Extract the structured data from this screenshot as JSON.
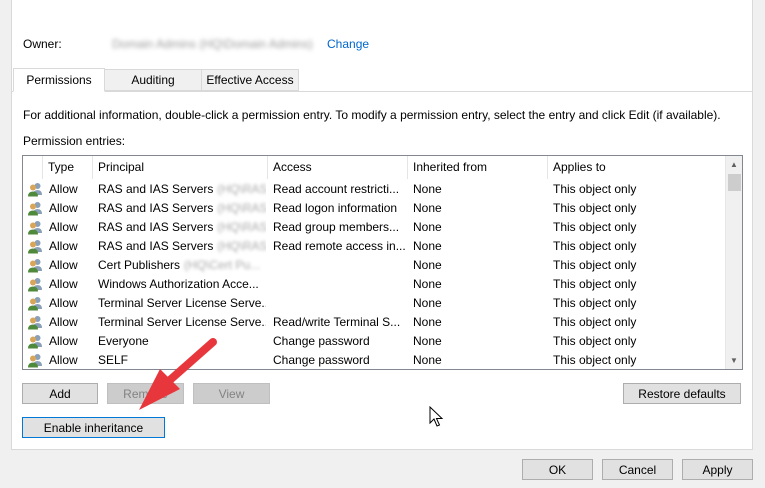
{
  "owner": {
    "label": "Owner:",
    "value": "Domain Admins (HQ\\Domain Admins)",
    "change_label": "Change"
  },
  "tabs": [
    {
      "label": "Permissions",
      "active": true
    },
    {
      "label": "Auditing",
      "active": false
    },
    {
      "label": "Effective Access",
      "active": false
    }
  ],
  "info_text": "For additional information, double-click a permission entry. To modify a permission entry, select the entry and click Edit (if available).",
  "entries_label": "Permission entries:",
  "columns": [
    "Type",
    "Principal",
    "Access",
    "Inherited from",
    "Applies to"
  ],
  "entries": [
    {
      "type": "Allow",
      "principal": "RAS and IAS Servers",
      "principal_hidden": "(HQ\\RAS...",
      "access": "Read account restricti...",
      "inherited": "None",
      "applies": "This object only"
    },
    {
      "type": "Allow",
      "principal": "RAS and IAS Servers",
      "principal_hidden": "(HQ\\RAS...",
      "access": "Read logon information",
      "inherited": "None",
      "applies": "This object only"
    },
    {
      "type": "Allow",
      "principal": "RAS and IAS Servers",
      "principal_hidden": "(HQ\\RAS...",
      "access": "Read group members...",
      "inherited": "None",
      "applies": "This object only"
    },
    {
      "type": "Allow",
      "principal": "RAS and IAS Servers",
      "principal_hidden": "(HQ\\RAS...",
      "access": "Read remote access in...",
      "inherited": "None",
      "applies": "This object only"
    },
    {
      "type": "Allow",
      "principal": "Cert Publishers",
      "principal_hidden": "(HQ\\Cert Pu...",
      "access": "",
      "inherited": "None",
      "applies": "This object only"
    },
    {
      "type": "Allow",
      "principal": "Windows Authorization Acce...",
      "principal_hidden": "",
      "access": "",
      "inherited": "None",
      "applies": "This object only"
    },
    {
      "type": "Allow",
      "principal": "Terminal Server License Serve...",
      "principal_hidden": "",
      "access": "",
      "inherited": "None",
      "applies": "This object only"
    },
    {
      "type": "Allow",
      "principal": "Terminal Server License Serve...",
      "principal_hidden": "",
      "access": "Read/write Terminal S...",
      "inherited": "None",
      "applies": "This object only"
    },
    {
      "type": "Allow",
      "principal": "Everyone",
      "principal_hidden": "",
      "access": "Change password",
      "inherited": "None",
      "applies": "This object only"
    },
    {
      "type": "Allow",
      "principal": "SELF",
      "principal_hidden": "",
      "access": "Change password",
      "inherited": "None",
      "applies": "This object only"
    }
  ],
  "buttons": {
    "add": "Add",
    "remove": "Remove",
    "view": "View",
    "restore": "Restore defaults",
    "enable_inheritance": "Enable inheritance",
    "ok": "OK",
    "cancel": "Cancel",
    "apply": "Apply"
  },
  "icons": {
    "user_group": "user-group-icon",
    "scroll_up": "chevron-up-icon",
    "scroll_down": "chevron-down-icon",
    "annotation": "red-arrow-icon",
    "cursor": "mouse-pointer-icon"
  },
  "colors": {
    "link": "#0066cc",
    "annotation_arrow": "#e8373c",
    "focus_border": "#0078d7"
  }
}
